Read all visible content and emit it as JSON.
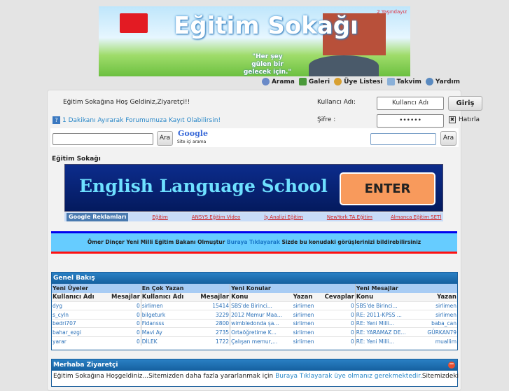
{
  "banner": {
    "title": "Eğitim Sokağı",
    "motto": "\"Her şey gülen bir gelecek için.\"",
    "age": "2 Yaşındayız"
  },
  "nav": [
    {
      "label": "Arama",
      "icon": "search-icon",
      "color": "#6a8ac8"
    },
    {
      "label": "Galeri",
      "icon": "gallery-icon",
      "color": "#4a9a3a"
    },
    {
      "label": "Üye Listesi",
      "icon": "members-icon",
      "color": "#d8a030"
    },
    {
      "label": "Takvim",
      "icon": "calendar-icon",
      "color": "#8ab0d8"
    },
    {
      "label": "Yardım",
      "icon": "help-icon",
      "color": "#5a8ac0"
    }
  ],
  "welcome": "Eğitim Sokağına Hoş Geldiniz,Ziyaretçi!!",
  "register_link": "1 Dakikanı Ayırarak Forumumuza Kayıt Olabilirsin!",
  "login": {
    "username_label": "Kullancı Adı:",
    "username_value": "Kullancı Adı",
    "password_label": "Şifre :",
    "password_value": "••••••",
    "submit": "Giriş",
    "remember": "Hatırla"
  },
  "search": {
    "button": "Ara",
    "google": "Google",
    "google_sub": "Site içi arama",
    "button2": "Ara"
  },
  "section_title": "Eğitim Sokağı",
  "ad": {
    "title": "English Language School",
    "enter": "ENTER",
    "label": "Google Reklamları",
    "links": [
      "Eğitim",
      "ANSYS Eğitim Video",
      "İş Analizi Eğitim",
      "NewYork TA Eğitim",
      "Almanca Eğitim SETİ"
    ]
  },
  "announcement": {
    "before": "Ömer Dinçer Yeni Milli Eğitim Bakanı Olmuştur ",
    "link": "Buraya Tıklayarak",
    "after": " Sizde bu konudaki görüşlerinizi bildirebilirsiniz"
  },
  "overview": {
    "title": "Genel Bakış",
    "sections": [
      "Yeni Üyeler",
      "En Çok Yazan",
      "Yeni Konular",
      "Yeni Mesajlar"
    ],
    "headers": [
      "Kullanıcı Adı",
      "Mesajlar",
      "Kullanıcı Adı",
      "Mesajlar",
      "Konu",
      "Yazan",
      "Cevaplar",
      "Konu",
      "Yazan"
    ],
    "rows": [
      [
        "dyg",
        "0",
        "sirlimen",
        "15414",
        "SBS'de Birinci...",
        "sirlimen",
        "0",
        "SBS'de Birinci...",
        "sirlimen"
      ],
      [
        "s_cyln",
        "0",
        "bilgeturk",
        "3229",
        "2012 Memur Maa...",
        "sirlimen",
        "0",
        "RE: 2011-KPSS ...",
        "sirlimen"
      ],
      [
        "bedri707",
        "0",
        "Fidansss",
        "2800",
        "wimbledonda şa...",
        "sirlimen",
        "0",
        "RE: Yeni Milli...",
        "baba_can"
      ],
      [
        "bahar_ezgi",
        "0",
        "Mavi Ay",
        "2735",
        "Ortaöğretime K...",
        "sirlimen",
        "0",
        "RE: YARAMAZ DE...",
        "GÜRKAN79"
      ],
      [
        "yarar",
        "0",
        "DİLEK",
        "1722",
        "Çalışan memur,...",
        "sirlimen",
        "0",
        "RE: Yeni Milli...",
        "muallim"
      ]
    ]
  },
  "guest": {
    "title": "Merhaba Ziyaretçi",
    "text_before": "Eğitim Sokağına Hoşgeldiniz...Sitemizden daha fazla yararlanmak için ",
    "link": "Buraya Tıklayarak üye olmanız gerekmektedir.",
    "text_after": "Sitemizdeki"
  }
}
